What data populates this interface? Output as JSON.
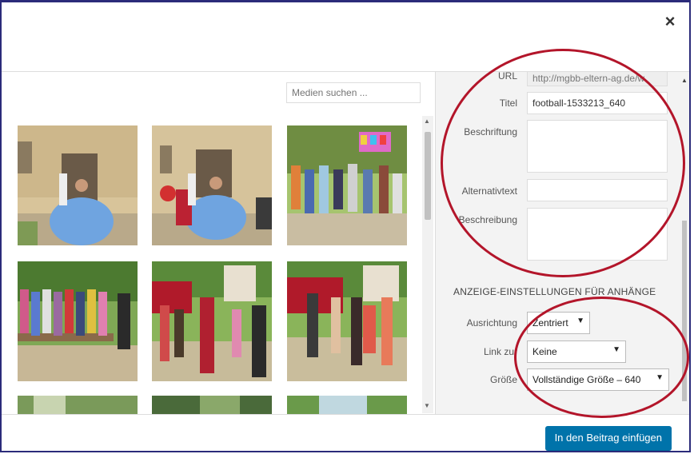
{
  "dialog": {
    "close_label": "×"
  },
  "library": {
    "search_placeholder": "Medien suchen ..."
  },
  "details": {
    "url_label": "URL",
    "url_value": "http://mgbb-eltern-ag.de/w",
    "title_label": "Titel",
    "title_value": "football-1533213_640",
    "caption_label": "Beschriftung",
    "caption_value": "",
    "alt_label": "Alternativtext",
    "alt_value": "",
    "description_label": "Beschreibung",
    "description_value": ""
  },
  "display_settings": {
    "heading": "ANZEIGE-EINSTELLUNGEN FÜR ANHÄNGE",
    "alignment_label": "Ausrichtung",
    "alignment_value": "Zentriert",
    "link_label": "Link zur",
    "link_value": "Keine",
    "size_label": "Größe",
    "size_value": "Vollständige Größe – 640"
  },
  "footer": {
    "insert_button": "In den Beitrag einfügen"
  },
  "colors": {
    "accent": "#0073aa",
    "annotation": "#b3152a",
    "frame": "#2b2b7a"
  }
}
